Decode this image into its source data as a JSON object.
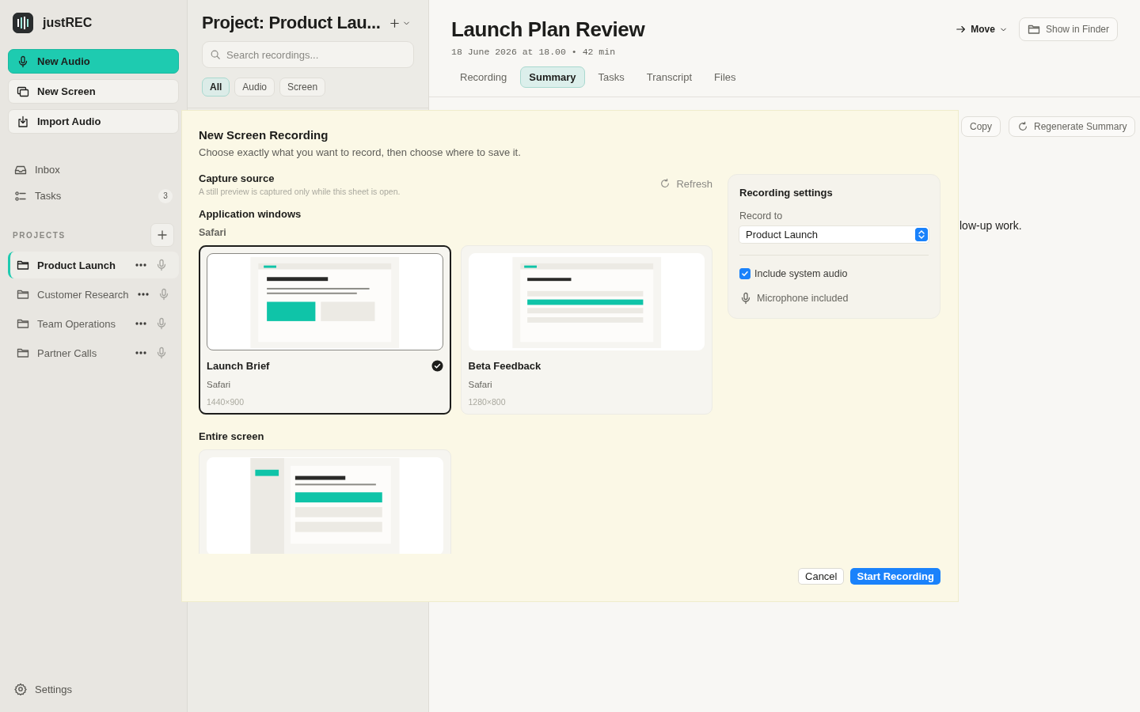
{
  "app": {
    "name": "justREC"
  },
  "sidebar": {
    "actions": [
      {
        "label": "New Audio",
        "kind": "primary"
      },
      {
        "label": "New Screen",
        "kind": "secondary"
      },
      {
        "label": "Import Audio",
        "kind": "secondary"
      }
    ],
    "nav": [
      {
        "label": "Inbox"
      },
      {
        "label": "Tasks",
        "count": "3"
      }
    ],
    "projects_heading": "PROJECTS",
    "projects": [
      {
        "name": "Product Launch",
        "selected": true
      },
      {
        "name": "Customer Research",
        "selected": false
      },
      {
        "name": "Team Operations",
        "selected": false
      },
      {
        "name": "Partner Calls",
        "selected": false
      }
    ],
    "settings": "Settings"
  },
  "list_panel": {
    "title": "Project: Product Lau...",
    "search": {
      "placeholder": "Search recordings..."
    },
    "filters": [
      {
        "label": "All",
        "selected": true
      },
      {
        "label": "Audio",
        "selected": false
      },
      {
        "label": "Screen",
        "selected": false
      }
    ]
  },
  "recording": {
    "title": "Launch Plan Review",
    "meta": "18 June 2026 at 18.00 • 42 min",
    "move": "Move",
    "show_in_finder": "Show in Finder",
    "tabs": [
      {
        "label": "Recording",
        "selected": false
      },
      {
        "label": "Summary",
        "selected": true
      },
      {
        "label": "Tasks",
        "selected": false
      },
      {
        "label": "Transcript",
        "selected": false
      },
      {
        "label": "Files",
        "selected": false
      }
    ],
    "copy": "Copy",
    "regenerate": "Regenerate Summary",
    "body_text": "low-up work."
  },
  "sheet": {
    "title": "New Screen Recording",
    "subtitle": "Choose exactly what you want to record, then choose where to save it.",
    "capture_source": {
      "title": "Capture source",
      "hint": "A still preview is captured only while this sheet is open.",
      "refresh": "Refresh"
    },
    "application_windows": "Application windows",
    "app_group": "Safari",
    "windows": [
      {
        "title": "Launch Brief",
        "app": "Safari",
        "size": "1440×900",
        "selected": true,
        "kind": "brief"
      },
      {
        "title": "Beta Feedback",
        "app": "Safari",
        "size": "1280×800",
        "selected": false,
        "kind": "list"
      }
    ],
    "entire_screen": "Entire screen",
    "settings": {
      "title": "Recording settings",
      "record_to_label": "Record to",
      "record_to_value": "Product Launch",
      "include_system_audio": {
        "label": "Include system audio",
        "checked": true
      },
      "microphone": "Microphone included"
    },
    "cancel": "Cancel",
    "start": "Start Recording"
  }
}
